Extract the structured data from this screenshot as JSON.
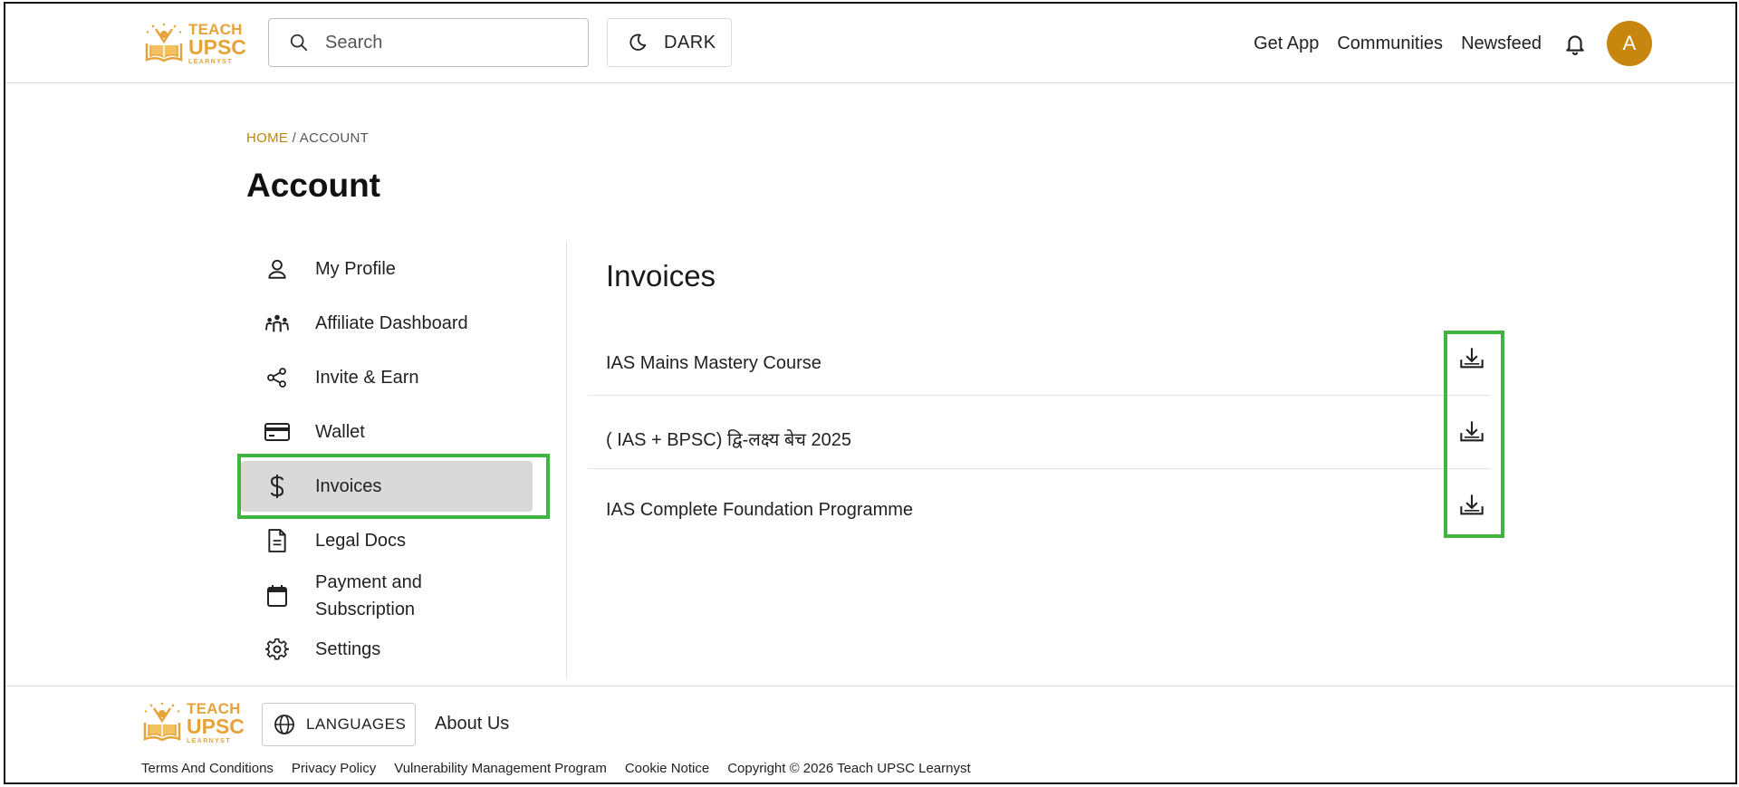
{
  "header": {
    "logo": {
      "line1": "TEACH",
      "line2": "UPSC",
      "line3": "LEARNYST"
    },
    "search_placeholder": "Search",
    "theme_toggle_label": "DARK",
    "nav": [
      "Get App",
      "Communities",
      "Newsfeed"
    ],
    "avatar_initial": "A"
  },
  "breadcrumb": {
    "home": "HOME",
    "separator": " / ",
    "current": "ACCOUNT"
  },
  "page_title": "Account",
  "sidebar": {
    "items": [
      {
        "label": "My Profile",
        "icon": "user-icon"
      },
      {
        "label": "Affiliate Dashboard",
        "icon": "group-icon"
      },
      {
        "label": "Invite & Earn",
        "icon": "share-icon"
      },
      {
        "label": "Wallet",
        "icon": "credit-card-icon"
      },
      {
        "label": "Invoices",
        "icon": "dollar-icon",
        "active": true
      },
      {
        "label": "Legal Docs",
        "icon": "document-icon"
      },
      {
        "label": "Payment and Subscription",
        "icon": "calendar-icon"
      },
      {
        "label": "Settings",
        "icon": "gear-icon"
      }
    ]
  },
  "content": {
    "title": "Invoices",
    "invoices": [
      {
        "name": "IAS Mains Mastery Course"
      },
      {
        "name": "( IAS + BPSC) द्वि-लक्ष्य बेच 2025"
      },
      {
        "name": "IAS Complete Foundation Programme"
      }
    ]
  },
  "footer": {
    "languages_label": "LANGUAGES",
    "about": "About Us",
    "links": [
      "Terms And Conditions",
      "Privacy Policy",
      "Vulnerability Management Program",
      "Cookie Notice",
      "Copyright © 2026 Teach UPSC Learnyst"
    ]
  },
  "colors": {
    "accent": "#c7860d",
    "logo": "#e6a33a",
    "highlight": "#3fb53f",
    "active_bg": "#d9d9d9"
  }
}
